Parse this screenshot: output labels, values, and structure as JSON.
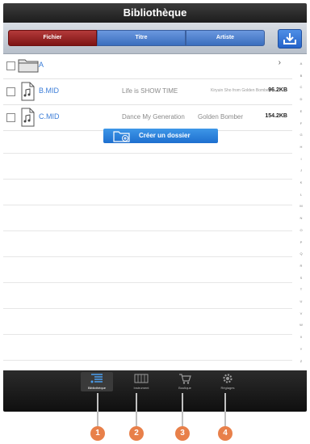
{
  "header": {
    "title": "Bibliothèque"
  },
  "segments": {
    "fichier": "Fichier",
    "titre": "Titre",
    "artiste": "Artiste"
  },
  "rows": [
    {
      "name": "A",
      "type": "folder"
    },
    {
      "name": "B.MID",
      "title": "Life is SHOW TIME",
      "artist": "Kiryuin Sho from Golden Bomber",
      "size": "96.2KB",
      "type": "file"
    },
    {
      "name": "C.MID",
      "title": "Dance My Generation",
      "artist": "Golden Bomber",
      "size": "154.2KB",
      "type": "file"
    }
  ],
  "create_folder": {
    "label": "Créer un dossier"
  },
  "index_letters": [
    "A",
    "B",
    "C",
    "D",
    "E",
    "F",
    "G",
    "H",
    "I",
    "J",
    "K",
    "L",
    "M",
    "N",
    "O",
    "P",
    "Q",
    "R",
    "S",
    "T",
    "U",
    "V",
    "W",
    "X",
    "Y",
    "Z",
    "0"
  ],
  "tabs": [
    {
      "label": "Bibliothèque"
    },
    {
      "label": "Instrument"
    },
    {
      "label": "Boutique"
    },
    {
      "label": "Réglages"
    }
  ],
  "callouts": [
    "1",
    "2",
    "3",
    "4"
  ],
  "colors": {
    "accent": "#3b7dd8",
    "fichier_active": "#8e1f1f",
    "callout": "#e8804a"
  },
  "icons": {
    "download": "download-icon",
    "folder": "folder-icon",
    "music_file": "music-file-icon",
    "new_folder": "new-folder-icon",
    "library": "library-icon",
    "instrument": "keyboard-icon",
    "shop": "cart-icon",
    "settings": "gear-icon"
  }
}
